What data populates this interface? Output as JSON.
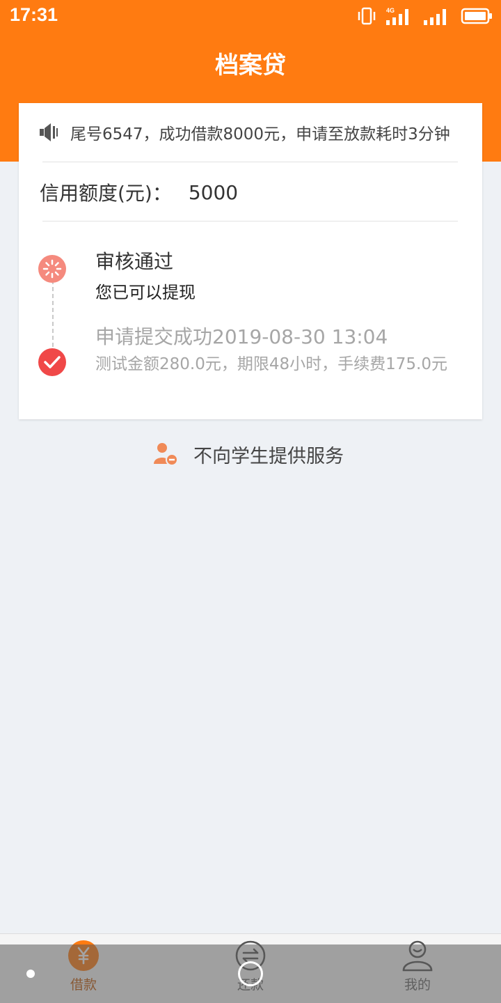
{
  "status_bar": {
    "time": "17:31",
    "network_label": "4G",
    "icons": [
      "vibrate-icon",
      "signal-4g-icon",
      "signal-icon",
      "battery-icon"
    ]
  },
  "header": {
    "title": "档案贷",
    "background_color": "#ff7b11"
  },
  "card": {
    "notice": {
      "icon": "speaker-icon",
      "text": "尾号6547，成功借款8000元，申请至放款耗时3分钟"
    },
    "credit": {
      "label": "信用额度(元)：",
      "value": "5000"
    },
    "timeline": [
      {
        "status_icon": "loading-icon",
        "title": "审核通过",
        "subtitle": "您已可以提现",
        "active": true
      },
      {
        "status_icon": "check-circle-icon",
        "title": "申请提交成功2019-08-30 13:04",
        "subtitle": "测试金额280.0元，期限48小时，手续费175.0元",
        "active": false
      }
    ]
  },
  "student_notice": {
    "icon": "user-minus-icon",
    "text": "不向学生提供服务"
  },
  "bottom_nav": {
    "items": [
      {
        "label": "借款",
        "icon": "yuan-icon",
        "active": true
      },
      {
        "label": "还款",
        "icon": "repay-icon",
        "active": false
      },
      {
        "label": "我的",
        "icon": "user-icon",
        "active": false
      }
    ]
  },
  "colors": {
    "accent": "#ff7b11",
    "active_tab": "#c25a0a",
    "success": "#f04848",
    "pending": "#f58a7e",
    "muted_text": "#a6a6a6"
  }
}
